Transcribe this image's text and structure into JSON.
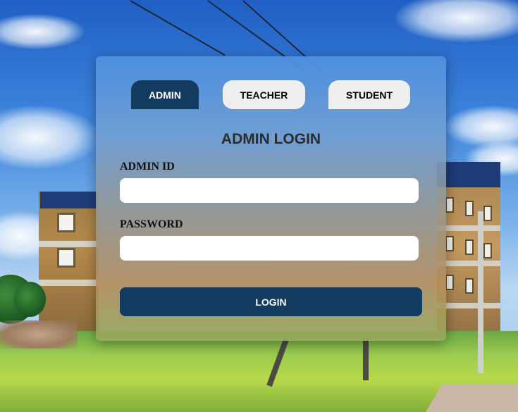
{
  "tabs": {
    "admin": "ADMIN",
    "teacher": "TEACHER",
    "student": "STUDENT",
    "active": "ADMIN"
  },
  "form": {
    "title": "ADMIN LOGIN",
    "id_label": "ADMIN ID",
    "id_value": "",
    "password_label": "PASSWORD",
    "password_value": "",
    "submit_label": "LOGIN"
  },
  "colors": {
    "primary": "#133b60",
    "tab_inactive": "#efefef",
    "input_background": "#ffffff"
  }
}
